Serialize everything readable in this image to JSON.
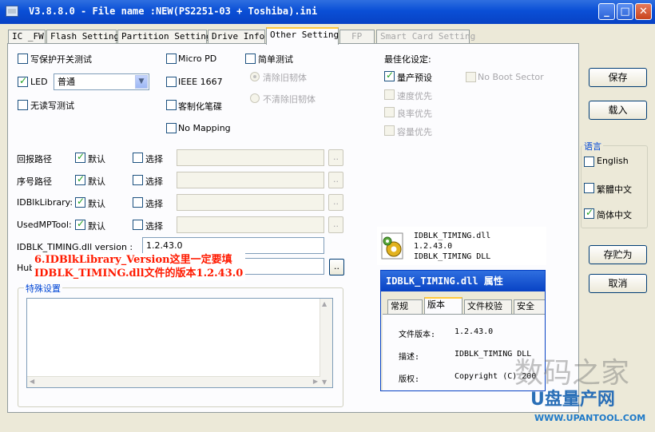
{
  "window": {
    "title": "V3.8.8.0 - File name :NEW(PS2251-03 + Toshiba).ini"
  },
  "tabs": [
    {
      "label": "IC _FW",
      "state": "normal"
    },
    {
      "label": "Flash Setting",
      "state": "normal"
    },
    {
      "label": "Partition Setting",
      "state": "normal"
    },
    {
      "label": "Drive Info",
      "state": "normal"
    },
    {
      "label": "Other Setting",
      "state": "active"
    },
    {
      "label": "FP",
      "state": "disabled"
    },
    {
      "label": "Smart Card Setting",
      "state": "disabled"
    }
  ],
  "options": {
    "write_protect_test": {
      "label": "写保护开关测试",
      "checked": false
    },
    "led": {
      "label": "LED",
      "checked": true,
      "select_value": "普通"
    },
    "no_rw_test": {
      "label": "无读写测试",
      "checked": false
    },
    "micro_pd": {
      "label": "Micro PD",
      "checked": false
    },
    "ieee1667": {
      "label": "IEEE 1667",
      "checked": false
    },
    "custom_disk": {
      "label": "客制化笔碟",
      "checked": false
    },
    "no_mapping": {
      "label": "No Mapping",
      "checked": false
    },
    "simple_test": {
      "label": "简单测试",
      "checked": false
    },
    "clear_old_fw": {
      "label": "清除旧韧体"
    },
    "keep_old_fw": {
      "label": "不清除旧韧体"
    }
  },
  "optimize": {
    "heading": "最佳化设定:",
    "items": [
      {
        "label": "量产预设",
        "checked": true,
        "enabled": true
      },
      {
        "label": "速度优先",
        "checked": false,
        "enabled": false
      },
      {
        "label": "良率优先",
        "checked": false,
        "enabled": false
      },
      {
        "label": "容量优先",
        "checked": false,
        "enabled": false
      }
    ],
    "no_boot_sector": "No Boot Sector"
  },
  "paths": [
    {
      "label": "回报路径",
      "default_label": "默认",
      "select_label": "选择"
    },
    {
      "label": "序号路径",
      "default_label": "默认",
      "select_label": "选择"
    },
    {
      "label": "IDBlkLibrary:",
      "default_label": "默认",
      "select_label": "选择"
    },
    {
      "label": "UsedMPTool:",
      "default_label": "默认",
      "select_label": "选择"
    }
  ],
  "timing": {
    "label": "IDBLK_TIMING.dll version :",
    "value": "1.2.43.0"
  },
  "hub": {
    "label": "Hub",
    "browse": ".."
  },
  "special": {
    "label": "特殊设置"
  },
  "buttons": {
    "save": "保存",
    "load": "载入",
    "save_as": "存贮为",
    "cancel": "取消"
  },
  "language": {
    "label": "语言",
    "options": [
      {
        "label": "English",
        "checked": false
      },
      {
        "label": "繁體中文",
        "checked": false
      },
      {
        "label": "简体中文",
        "checked": true
      }
    ]
  },
  "annotation": {
    "line1": "6.IDBlkLibrary_Version这里一定要填",
    "line2": "IDBLK_TIMING.dll文件的版本1.2.43.0"
  },
  "file_info": {
    "name": "IDBLK_TIMING.dll",
    "version": "1.2.43.0",
    "desc": "IDBLK_TIMING DLL"
  },
  "properties_dialog": {
    "title": "IDBLK_TIMING.dll 属性",
    "tabs": [
      "常规",
      "版本",
      "文件校验",
      "安全"
    ],
    "rows": [
      {
        "label": "文件版本:",
        "value": "1.2.43.0"
      },
      {
        "label": "描述:",
        "value": "IDBLK_TIMING DLL"
      },
      {
        "label": "版权:",
        "value": "Copyright (C) 200"
      }
    ]
  },
  "watermark": {
    "line1": "数码之家",
    "line2": "U盘量产网",
    "url": "WWW.UPANTOOL.COM"
  }
}
